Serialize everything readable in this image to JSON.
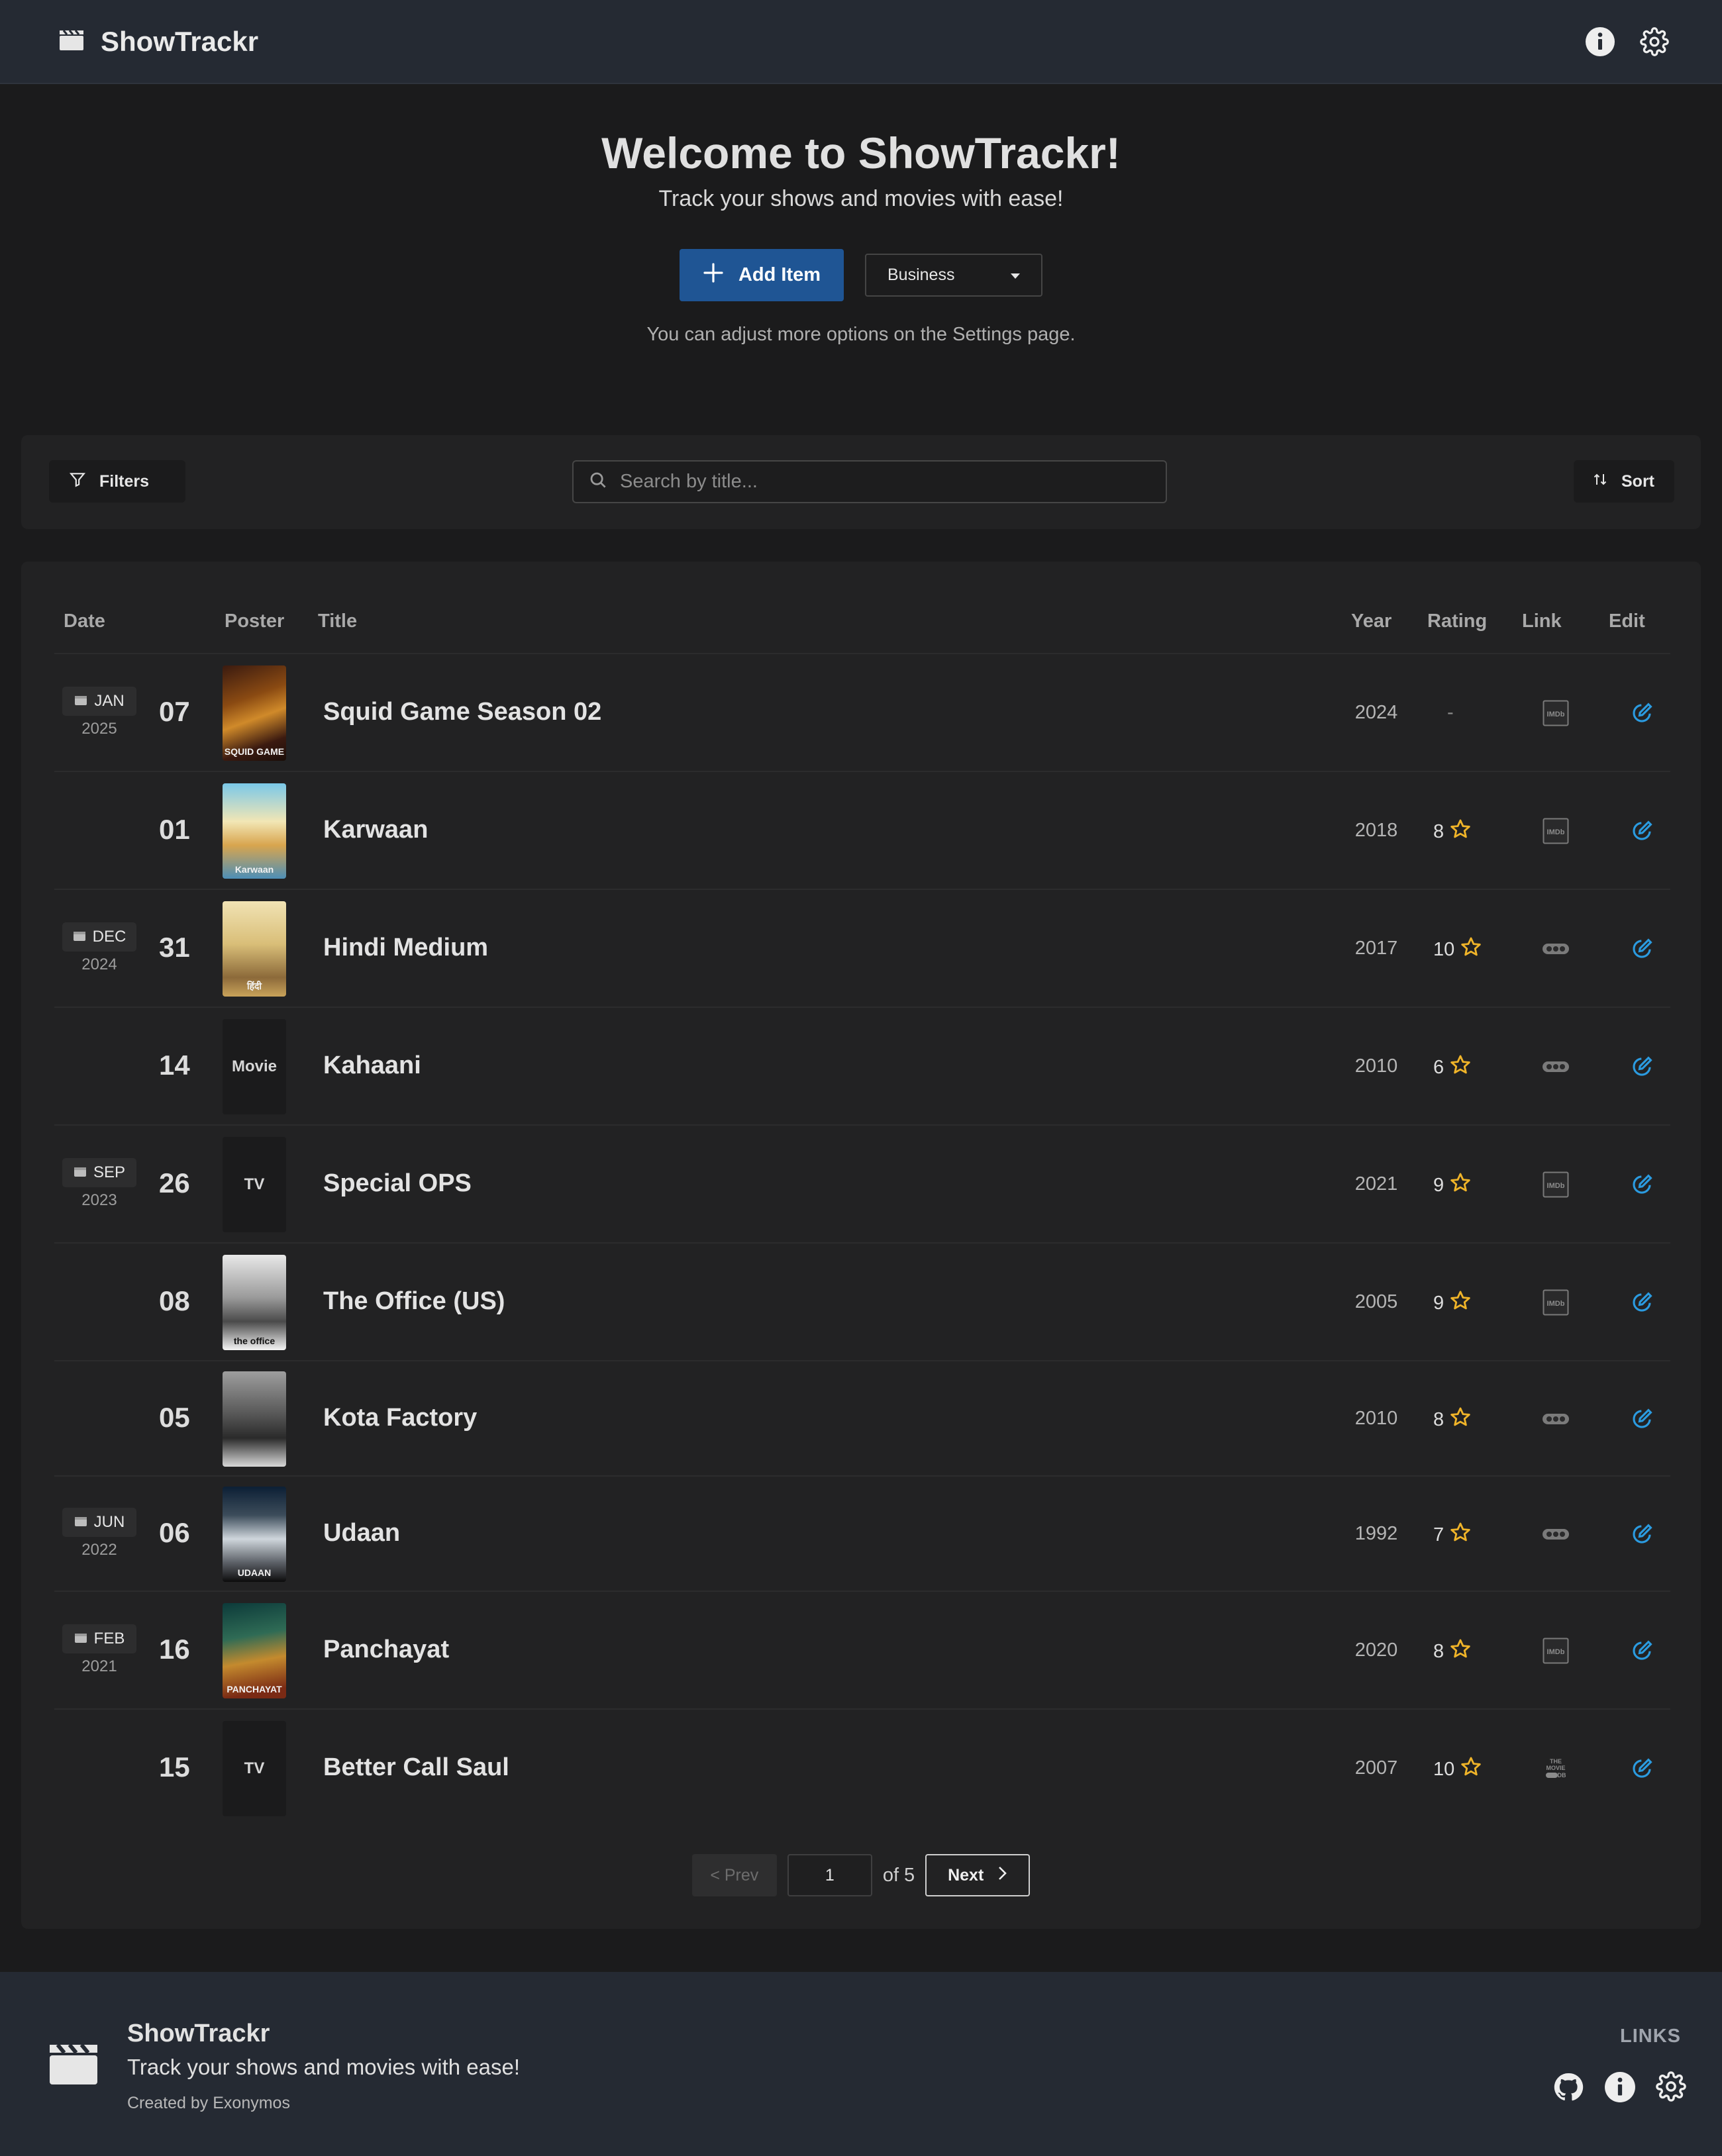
{
  "app": {
    "name": "ShowTrackr"
  },
  "hero": {
    "title": "Welcome to ShowTrackr!",
    "subtitle": "Track your shows and movies with ease!",
    "add_button": "Add Item",
    "list_select": "Business",
    "hint": "You can adjust more options on the Settings page."
  },
  "toolbar": {
    "filters_label": "Filters",
    "search_placeholder": "Search by title...",
    "sort_label": "Sort"
  },
  "table": {
    "headers": {
      "date": "Date",
      "poster": "Poster",
      "title": "Title",
      "year": "Year",
      "rating": "Rating",
      "link": "Link",
      "edit": "Edit"
    },
    "rows": [
      {
        "month": "JAN",
        "date_year": "2025",
        "day": "07",
        "poster": "image",
        "poster_style": "squid",
        "poster_caption": "SQUID GAME",
        "title": "Squid Game Season 02",
        "year": "2024",
        "rating": "-",
        "link": "imdb-icon"
      },
      {
        "month": "",
        "date_year": "",
        "day": "01",
        "poster": "image",
        "poster_style": "karwaan",
        "poster_caption": "Karwaan",
        "title": "Karwaan",
        "year": "2018",
        "rating": "8",
        "link": "imdb-icon"
      },
      {
        "month": "DEC",
        "date_year": "2024",
        "day": "31",
        "poster": "image",
        "poster_style": "hindi",
        "poster_caption": "हिंदी",
        "title": "Hindi Medium",
        "year": "2017",
        "rating": "10",
        "link": "more-dots-icon"
      },
      {
        "month": "",
        "date_year": "",
        "day": "14",
        "poster": "Movie",
        "poster_style": "",
        "poster_caption": "",
        "title": "Kahaani",
        "year": "2010",
        "rating": "6",
        "link": "more-dots-icon"
      },
      {
        "month": "SEP",
        "date_year": "2023",
        "day": "26",
        "poster": "TV",
        "poster_style": "",
        "poster_caption": "",
        "title": "Special OPS",
        "year": "2021",
        "rating": "9",
        "link": "imdb-icon"
      },
      {
        "month": "",
        "date_year": "",
        "day": "08",
        "poster": "image",
        "poster_style": "office",
        "poster_caption": "the office",
        "title": "The Office (US)",
        "year": "2005",
        "rating": "9",
        "link": "imdb-icon"
      },
      {
        "month": "",
        "date_year": "",
        "day": "05",
        "poster": "image",
        "poster_style": "kota",
        "poster_caption": "",
        "title": "Kota Factory",
        "year": "2010",
        "rating": "8",
        "link": "more-dots-icon"
      },
      {
        "month": "JUN",
        "date_year": "2022",
        "day": "06",
        "poster": "image",
        "poster_style": "udaan",
        "poster_caption": "UDAAN",
        "title": "Udaan",
        "year": "1992",
        "rating": "7",
        "link": "more-dots-icon"
      },
      {
        "month": "FEB",
        "date_year": "2021",
        "day": "16",
        "poster": "image",
        "poster_style": "panch",
        "poster_caption": "PANCHAYAT",
        "title": "Panchayat",
        "year": "2020",
        "rating": "8",
        "link": "imdb-icon"
      },
      {
        "month": "",
        "date_year": "",
        "day": "15",
        "poster": "TV",
        "poster_style": "",
        "poster_caption": "",
        "title": "Better Call Saul",
        "year": "2007",
        "rating": "10",
        "link": "tmdb-icon"
      }
    ]
  },
  "pagination": {
    "prev_label": "< Prev",
    "current_page": "1",
    "of_label": "of 5",
    "next_label": "Next"
  },
  "footer": {
    "name": "ShowTrackr",
    "tagline": "Track your shows and movies with ease!",
    "credit": "Created by Exonymos",
    "links_heading": "LINKS"
  },
  "colors": {
    "accent": "#1f5594",
    "edit_icon": "#2b9be0",
    "star": "#f0b429",
    "header_bg": "#252a33"
  }
}
